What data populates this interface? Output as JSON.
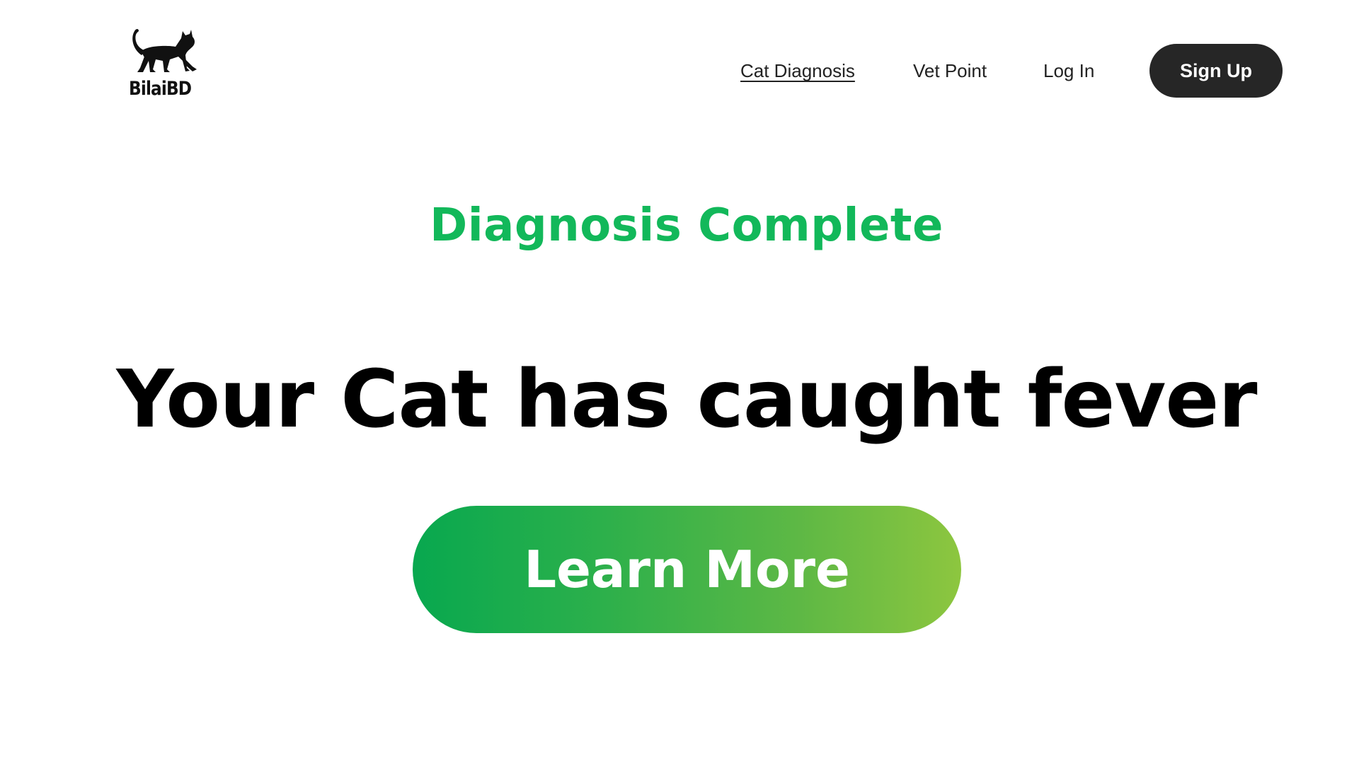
{
  "header": {
    "logo": {
      "icon": "cat-icon",
      "text": "BilaiBD"
    },
    "nav": {
      "items": [
        {
          "label": "Cat Diagnosis",
          "active": true
        },
        {
          "label": "Vet Point",
          "active": false
        },
        {
          "label": "Log In",
          "active": false
        }
      ],
      "signup_label": "Sign Up"
    }
  },
  "main": {
    "status": "Diagnosis Complete",
    "result": "Your Cat has caught fever",
    "cta_label": "Learn More"
  },
  "colors": {
    "status_green": "#12b85a",
    "signup_bg": "#262626",
    "cta_gradient_start": "#08a84f",
    "cta_gradient_end": "#8dc63f"
  }
}
